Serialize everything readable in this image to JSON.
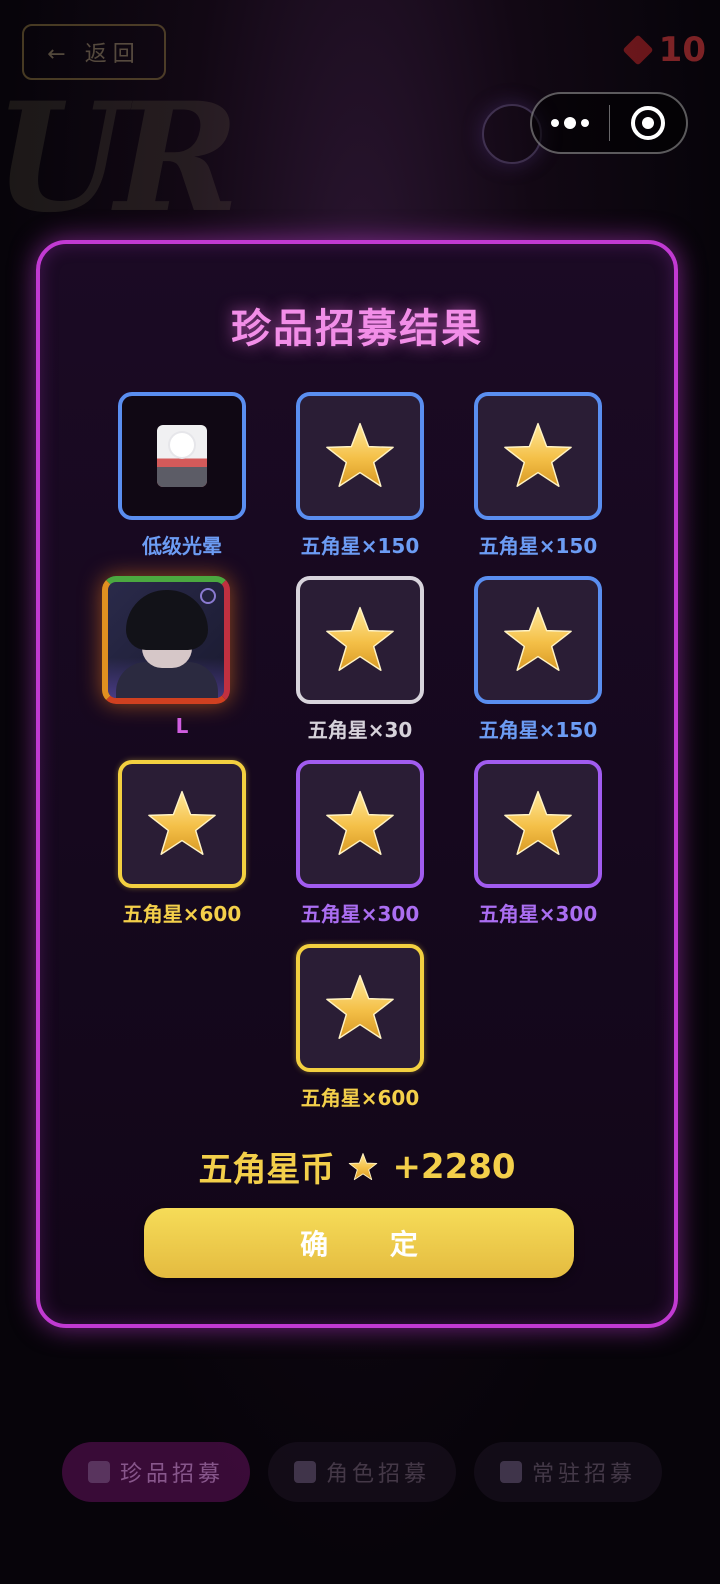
{
  "background": {
    "back_label": "← 返回",
    "gem_count": "10",
    "banner_text": "UR",
    "tabs": [
      {
        "label": "珍品招募",
        "active": true,
        "icon": "gem-icon"
      },
      {
        "label": "角色招募",
        "active": false,
        "icon": "mask-icon"
      },
      {
        "label": "常驻招募",
        "active": false,
        "icon": "temple-icon"
      }
    ]
  },
  "capsule": {
    "more_icon": "more-dots-icon",
    "close_icon": "close-target-icon"
  },
  "modal": {
    "title": "珍品招募结果",
    "results": [
      {
        "label": "低级光晕",
        "type": "frame-icon",
        "rarity": "blue"
      },
      {
        "label": "五角星×150",
        "type": "star-icon",
        "rarity": "blue"
      },
      {
        "label": "五角星×150",
        "type": "star-icon",
        "rarity": "blue"
      },
      {
        "label": "L",
        "type": "character-portrait",
        "rarity": "ur"
      },
      {
        "label": "五角星×30",
        "type": "star-icon",
        "rarity": "white"
      },
      {
        "label": "五角星×150",
        "type": "star-icon",
        "rarity": "blue"
      },
      {
        "label": "五角星×600",
        "type": "star-icon",
        "rarity": "gold"
      },
      {
        "label": "五角星×300",
        "type": "star-icon",
        "rarity": "purple"
      },
      {
        "label": "五角星×300",
        "type": "star-icon",
        "rarity": "purple"
      },
      {
        "label": "五角星×600",
        "type": "star-icon",
        "rarity": "gold"
      }
    ],
    "total_label": "五角星币",
    "total_value": "+2280",
    "confirm_label": "确 定"
  },
  "colors": {
    "modal_border": "#c13ad2",
    "title": "#f28ee8",
    "blue": "#5a8ef0",
    "gold": "#f3d040",
    "purple": "#a15cf0",
    "white": "#d8d4dc"
  }
}
